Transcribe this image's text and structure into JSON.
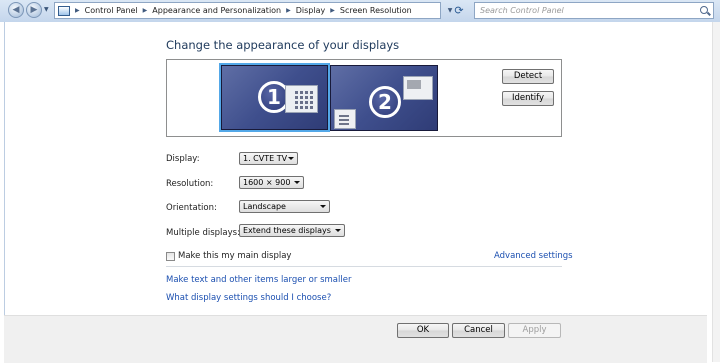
{
  "window": {
    "breadcrumbs": [
      "Control Panel",
      "Appearance and Personalization",
      "Display",
      "Screen Resolution"
    ],
    "search_placeholder": "Search Control Panel"
  },
  "page": {
    "title": "Change the appearance of your displays"
  },
  "monitors": [
    {
      "number": "1",
      "selected": true
    },
    {
      "number": "2",
      "selected": false
    }
  ],
  "buttons": {
    "detect": "Detect",
    "identify": "Identify",
    "ok": "OK",
    "cancel": "Cancel",
    "apply": "Apply"
  },
  "fields": {
    "display": {
      "label": "Display:",
      "value": "1. CVTE TV"
    },
    "resolution": {
      "label": "Resolution:",
      "value": "1600 × 900"
    },
    "orientation": {
      "label": "Orientation:",
      "value": "Landscape"
    },
    "multiple_displays": {
      "label": "Multiple displays:",
      "value": "Extend these displays"
    }
  },
  "main_display_checkbox": {
    "label": "Make this my main display",
    "checked": false
  },
  "links": {
    "advanced": "Advanced settings",
    "text_size": "Make text and other items larger or smaller",
    "help": "What display settings should I choose?"
  },
  "colors": {
    "link": "#1b4fb0",
    "title": "#1e395b",
    "monitor": "#3f4f8d",
    "selection_glow": "#53a8e8"
  }
}
